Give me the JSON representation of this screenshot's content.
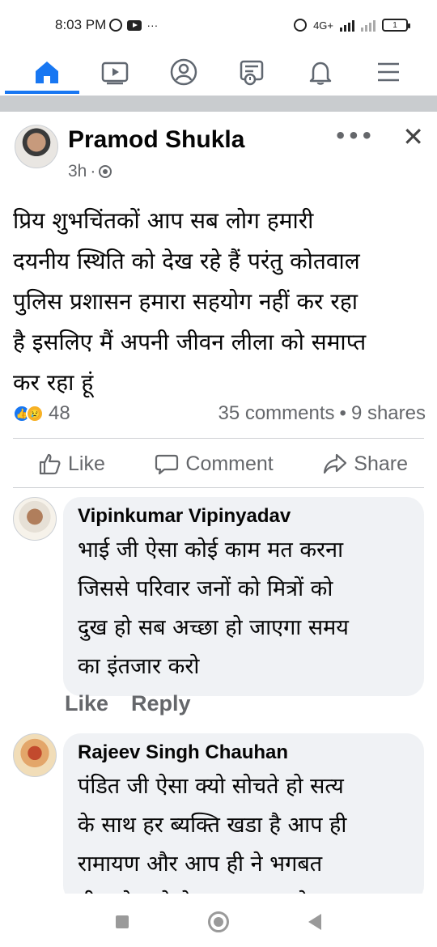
{
  "status_bar": {
    "time": "8:03 PM",
    "network_label": "4G+",
    "battery": "1"
  },
  "top_nav": {
    "items": [
      {
        "icon": "home-icon",
        "active": true
      },
      {
        "icon": "video-icon",
        "active": false
      },
      {
        "icon": "profile-icon",
        "active": false
      },
      {
        "icon": "news-feed-icon",
        "active": false
      },
      {
        "icon": "bell-icon",
        "active": false
      },
      {
        "icon": "menu-icon",
        "active": false
      }
    ],
    "accent_color": "#1877f2"
  },
  "post": {
    "author": "Pramod Shukla",
    "time": "3h",
    "separator": "·",
    "text_lines": [
      "प्रिय शुभचिंतकों आप सब लोग हमारी",
      "दयनीय स्थिति को देख रहे हैं परंतु कोतवाल",
      "पुलिस प्रशासन हमारा सहयोग नहीं कर रहा",
      "है इसलिए मैं अपनी जीवन लीला को समाप्त",
      "कर रहा हूं"
    ],
    "reaction_count": "48",
    "comments_count": "35 comments",
    "stats_separator": "•",
    "shares_count": "9 shares"
  },
  "actions": {
    "like": "Like",
    "comment": "Comment",
    "share": "Share"
  },
  "comments": [
    {
      "author": "Vipinkumar Vipinyadav",
      "text_lines": [
        "भाई जी ऐसा कोई काम मत करना",
        "जिससे परिवार जनों को  मित्रों को",
        "दुख हो सब अच्छा हो जाएगा समय",
        "का इंतजार करो"
      ],
      "like_label": "Like",
      "reply_label": "Reply"
    },
    {
      "author": "Rajeev Singh Chauhan",
      "text_lines": [
        "पंडित जी ऐसा क्यो सोचते हो सत्य",
        "के साथ हर ब्यक्ति खडा है आप ही",
        "रामायण और आप ही ने भगबत",
        "गीता  के बारे मे बताया   आप ऐसा"
      ]
    }
  ]
}
